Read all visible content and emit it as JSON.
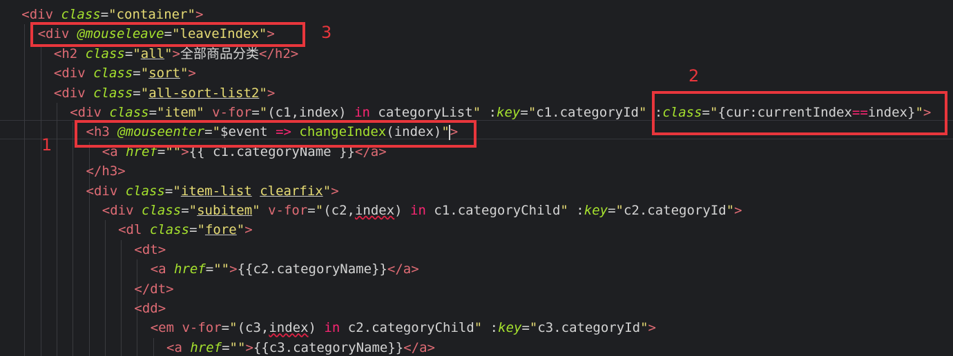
{
  "code_lines": [
    {
      "indent": 1,
      "tokens": [
        {
          "t": "<div ",
          "c": "tag"
        },
        {
          "t": "class",
          "c": "attr"
        },
        {
          "t": "=",
          "c": "plain"
        },
        {
          "t": "\"container\"",
          "c": "str"
        },
        {
          "t": ">",
          "c": "tag"
        }
      ]
    },
    {
      "indent": 2,
      "tokens": [
        {
          "t": "<div ",
          "c": "tag"
        },
        {
          "t": "@mouseleave",
          "c": "attr"
        },
        {
          "t": "=",
          "c": "plain"
        },
        {
          "t": "\"leaveIndex\"",
          "c": "str"
        },
        {
          "t": ">",
          "c": "tag"
        }
      ]
    },
    {
      "indent": 3,
      "tokens": [
        {
          "t": "<h2 ",
          "c": "tag"
        },
        {
          "t": "class",
          "c": "attr"
        },
        {
          "t": "=",
          "c": "plain"
        },
        {
          "t": "\"",
          "c": "str"
        },
        {
          "t": "all",
          "c": "str-ul"
        },
        {
          "t": "\"",
          "c": "str"
        },
        {
          "t": ">",
          "c": "tag"
        },
        {
          "t": "全部商品分类",
          "c": "plain"
        },
        {
          "t": "</h2>",
          "c": "tag"
        }
      ]
    },
    {
      "indent": 3,
      "tokens": [
        {
          "t": "<div ",
          "c": "tag"
        },
        {
          "t": "class",
          "c": "attr"
        },
        {
          "t": "=",
          "c": "plain"
        },
        {
          "t": "\"",
          "c": "str"
        },
        {
          "t": "sort",
          "c": "str-ul"
        },
        {
          "t": "\"",
          "c": "str"
        },
        {
          "t": ">",
          "c": "tag"
        }
      ]
    },
    {
      "indent": 3,
      "tokens": [
        {
          "t": "<div ",
          "c": "tag"
        },
        {
          "t": "class",
          "c": "attr"
        },
        {
          "t": "=",
          "c": "plain"
        },
        {
          "t": "\"",
          "c": "str"
        },
        {
          "t": "all-sort-list2",
          "c": "str-ul"
        },
        {
          "t": "\"",
          "c": "str"
        },
        {
          "t": ">",
          "c": "tag"
        }
      ]
    },
    {
      "indent": 4,
      "tokens": [
        {
          "t": "<div ",
          "c": "tag"
        },
        {
          "t": "class",
          "c": "attr"
        },
        {
          "t": "=",
          "c": "plain"
        },
        {
          "t": "\"item\"",
          "c": "str"
        },
        {
          "t": " v-for",
          "c": "tag"
        },
        {
          "t": "=",
          "c": "plain"
        },
        {
          "t": "\"",
          "c": "str"
        },
        {
          "t": "(c1,index) ",
          "c": "plain"
        },
        {
          "t": "in",
          "c": "kw"
        },
        {
          "t": " categoryList",
          "c": "plain"
        },
        {
          "t": "\"",
          "c": "str"
        },
        {
          "t": " :",
          "c": "plain"
        },
        {
          "t": "key",
          "c": "attr"
        },
        {
          "t": "=",
          "c": "plain"
        },
        {
          "t": "\"",
          "c": "str"
        },
        {
          "t": "c1.categoryId",
          "c": "plain"
        },
        {
          "t": "\"",
          "c": "str"
        },
        {
          "t": " :",
          "c": "plain"
        },
        {
          "t": "class",
          "c": "attr"
        },
        {
          "t": "=",
          "c": "plain"
        },
        {
          "t": "\"",
          "c": "str"
        },
        {
          "t": "{cur:currentIndex",
          "c": "plain"
        },
        {
          "t": "==",
          "c": "kw"
        },
        {
          "t": "index}",
          "c": "plain"
        },
        {
          "t": "\"",
          "c": "str"
        },
        {
          "t": ">",
          "c": "tag"
        }
      ]
    },
    {
      "indent": 5,
      "tokens": [
        {
          "t": "<h3 ",
          "c": "tag"
        },
        {
          "t": "@mouseenter",
          "c": "attr"
        },
        {
          "t": "=",
          "c": "plain"
        },
        {
          "t": "\"",
          "c": "str"
        },
        {
          "t": "$event",
          "c": "plain"
        },
        {
          "t": " => ",
          "c": "kw"
        },
        {
          "t": "changeIndex",
          "c": "func"
        },
        {
          "t": "(index)",
          "c": "plain"
        },
        {
          "t": "\"",
          "c": "str"
        },
        {
          "t": "|",
          "c": "caret"
        },
        {
          "t": ">",
          "c": "tag"
        }
      ]
    },
    {
      "indent": 6,
      "tokens": [
        {
          "t": "<a ",
          "c": "tag"
        },
        {
          "t": "href",
          "c": "attr"
        },
        {
          "t": "=",
          "c": "plain"
        },
        {
          "t": "\"\"",
          "c": "str"
        },
        {
          "t": ">",
          "c": "tag"
        },
        {
          "t": "{{ c1.categoryName }}",
          "c": "plain"
        },
        {
          "t": "</a>",
          "c": "tag"
        }
      ]
    },
    {
      "indent": 5,
      "tokens": [
        {
          "t": "</h3>",
          "c": "tag"
        }
      ]
    },
    {
      "indent": 5,
      "tokens": [
        {
          "t": "<div ",
          "c": "tag"
        },
        {
          "t": "class",
          "c": "attr"
        },
        {
          "t": "=",
          "c": "plain"
        },
        {
          "t": "\"",
          "c": "str"
        },
        {
          "t": "item-list",
          "c": "str-ul"
        },
        {
          "t": " ",
          "c": "str"
        },
        {
          "t": "clearfix",
          "c": "str-ul"
        },
        {
          "t": "\"",
          "c": "str"
        },
        {
          "t": ">",
          "c": "tag"
        }
      ]
    },
    {
      "indent": 6,
      "tokens": [
        {
          "t": "<div ",
          "c": "tag"
        },
        {
          "t": "class",
          "c": "attr"
        },
        {
          "t": "=",
          "c": "plain"
        },
        {
          "t": "\"",
          "c": "str"
        },
        {
          "t": "subitem",
          "c": "str-ul"
        },
        {
          "t": "\"",
          "c": "str"
        },
        {
          "t": " v-for",
          "c": "tag"
        },
        {
          "t": "=",
          "c": "plain"
        },
        {
          "t": "\"",
          "c": "str"
        },
        {
          "t": "(c2,",
          "c": "plain"
        },
        {
          "t": "index",
          "c": "plain-wavy"
        },
        {
          "t": ") ",
          "c": "plain"
        },
        {
          "t": "in",
          "c": "kw"
        },
        {
          "t": " c1.categoryChild",
          "c": "plain"
        },
        {
          "t": "\"",
          "c": "str"
        },
        {
          "t": " :",
          "c": "plain"
        },
        {
          "t": "key",
          "c": "attr"
        },
        {
          "t": "=",
          "c": "plain"
        },
        {
          "t": "\"",
          "c": "str"
        },
        {
          "t": "c2.categoryId",
          "c": "plain"
        },
        {
          "t": "\"",
          "c": "str"
        },
        {
          "t": ">",
          "c": "tag"
        }
      ]
    },
    {
      "indent": 7,
      "tokens": [
        {
          "t": "<dl ",
          "c": "tag"
        },
        {
          "t": "class",
          "c": "attr"
        },
        {
          "t": "=",
          "c": "plain"
        },
        {
          "t": "\"",
          "c": "str"
        },
        {
          "t": "fore",
          "c": "str-ul"
        },
        {
          "t": "\"",
          "c": "str"
        },
        {
          "t": ">",
          "c": "tag"
        }
      ]
    },
    {
      "indent": 8,
      "tokens": [
        {
          "t": "<dt>",
          "c": "tag"
        }
      ]
    },
    {
      "indent": 9,
      "tokens": [
        {
          "t": "<a ",
          "c": "tag"
        },
        {
          "t": "href",
          "c": "attr"
        },
        {
          "t": "=",
          "c": "plain"
        },
        {
          "t": "\"\"",
          "c": "str"
        },
        {
          "t": ">",
          "c": "tag"
        },
        {
          "t": "{{c2.categoryName}}",
          "c": "plain"
        },
        {
          "t": "</a>",
          "c": "tag"
        }
      ]
    },
    {
      "indent": 8,
      "tokens": [
        {
          "t": "</dt>",
          "c": "tag"
        }
      ]
    },
    {
      "indent": 8,
      "tokens": [
        {
          "t": "<dd>",
          "c": "tag"
        }
      ]
    },
    {
      "indent": 9,
      "tokens": [
        {
          "t": "<em ",
          "c": "tag"
        },
        {
          "t": "v-for",
          "c": "tag"
        },
        {
          "t": "=",
          "c": "plain"
        },
        {
          "t": "\"",
          "c": "str"
        },
        {
          "t": "(c3,",
          "c": "plain"
        },
        {
          "t": "index",
          "c": "plain-wavy"
        },
        {
          "t": ") ",
          "c": "plain"
        },
        {
          "t": "in",
          "c": "kw"
        },
        {
          "t": " c2.categoryChild",
          "c": "plain"
        },
        {
          "t": "\"",
          "c": "str"
        },
        {
          "t": " :",
          "c": "plain"
        },
        {
          "t": "key",
          "c": "attr"
        },
        {
          "t": "=",
          "c": "plain"
        },
        {
          "t": "\"",
          "c": "str"
        },
        {
          "t": "c3.categoryId",
          "c": "plain"
        },
        {
          "t": "\"",
          "c": "str"
        },
        {
          "t": ">",
          "c": "tag"
        }
      ]
    },
    {
      "indent": 10,
      "tokens": [
        {
          "t": "<a ",
          "c": "tag"
        },
        {
          "t": "href",
          "c": "attr"
        },
        {
          "t": "=",
          "c": "plain"
        },
        {
          "t": "\"\"",
          "c": "str"
        },
        {
          "t": ">",
          "c": "tag"
        },
        {
          "t": "{{c3.categoryName}}",
          "c": "plain"
        },
        {
          "t": "</a>",
          "c": "tag"
        }
      ]
    }
  ],
  "annotations": {
    "box1_label": "1",
    "box2_label": "2",
    "box3_label": "3"
  },
  "colors": {
    "background": "#1e1f22",
    "annotation_red": "#e8363c"
  }
}
